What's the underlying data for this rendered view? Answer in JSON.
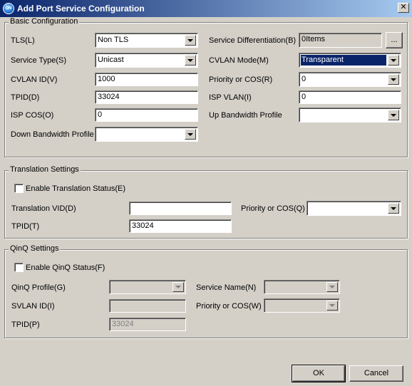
{
  "window": {
    "title": "Add Port Service Configuration",
    "close_label": "✕",
    "icon_text": "ON"
  },
  "basic": {
    "title": "Basic Configuration",
    "tls_label": "TLS(L)",
    "tls_value": "Non TLS",
    "service_type_label": "Service Type(S)",
    "service_type_value": "Unicast",
    "cvlan_id_label": "CVLAN ID(V)",
    "cvlan_id_value": "1000",
    "tpid_label": "TPID(D)",
    "tpid_value": "33024",
    "isp_cos_label": "ISP COS(O)",
    "isp_cos_value": "0",
    "down_bw_label": "Down Bandwidth Profile",
    "down_bw_value": "",
    "service_diff_label": "Service Differentiation(B)",
    "service_diff_value": "0Items",
    "service_diff_button": "...",
    "cvlan_mode_label": "CVLAN Mode(M)",
    "cvlan_mode_value": "Transparent",
    "priority_label": "Priority or COS(R)",
    "priority_value": "0",
    "isp_vlan_label": "ISP VLAN(I)",
    "isp_vlan_value": "0",
    "up_bw_label": "Up Bandwidth Profile",
    "up_bw_value": ""
  },
  "translation": {
    "title": "Translation Settings",
    "enable_label": "Enable Translation Status(E)",
    "vid_label": "Translation VID(D)",
    "vid_value": "",
    "priority_label": "Priority or COS(Q)",
    "priority_value": "",
    "tpid_label": "TPID(T)",
    "tpid_value": "33024"
  },
  "qinq": {
    "title": "QinQ Settings",
    "enable_label": "Enable QinQ Status(F)",
    "profile_label": "QinQ Profile(G)",
    "profile_value": "",
    "service_name_label": "Service Name(N)",
    "service_name_value": "",
    "svlan_label": "SVLAN ID(I)",
    "svlan_value": "",
    "priority_label": "Priority or COS(W)",
    "priority_value": "",
    "tpid_label": "TPID(P)",
    "tpid_value": "33024"
  },
  "buttons": {
    "ok": "OK",
    "cancel": "Cancel"
  }
}
